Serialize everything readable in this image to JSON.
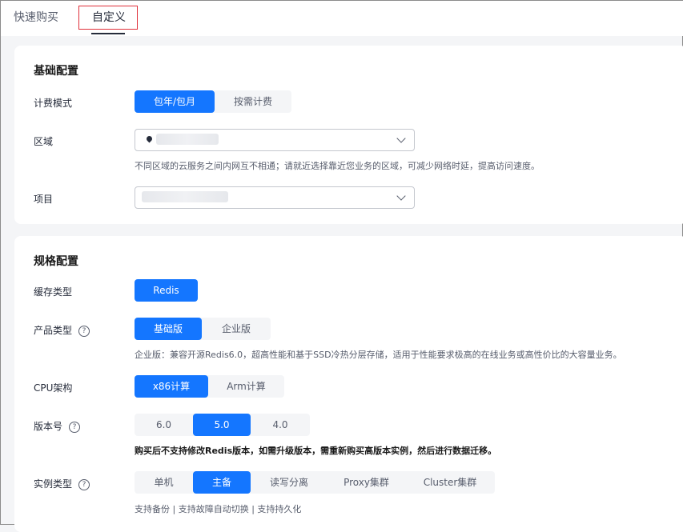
{
  "tabs": {
    "quick": "快速购买",
    "custom": "自定义"
  },
  "basic": {
    "title": "基础配置",
    "billing": {
      "label": "计费模式",
      "options": [
        "包年/包月",
        "按需计费"
      ],
      "selected": "包年/包月"
    },
    "region": {
      "label": "区域",
      "hint": "不同区域的云服务之间内网互不相通；请就近选择靠近您业务的区域，可减少网络时延，提高访问速度。"
    },
    "project": {
      "label": "项目"
    }
  },
  "spec": {
    "title": "规格配置",
    "cache_type": {
      "label": "缓存类型",
      "options": [
        "Redis"
      ],
      "selected": "Redis"
    },
    "product_type": {
      "label": "产品类型",
      "options": [
        "基础版",
        "企业版"
      ],
      "selected": "基础版",
      "hint": "企业版：兼容开源Redis6.0，超高性能和基于SSD冷热分层存储，适用于性能要求极高的在线业务或高性价比的大容量业务。"
    },
    "cpu": {
      "label": "CPU架构",
      "options": [
        "x86计算",
        "Arm计算"
      ],
      "selected": "x86计算"
    },
    "version": {
      "label": "版本号",
      "options": [
        "6.0",
        "5.0",
        "4.0"
      ],
      "selected": "5.0",
      "warning": "购买后不支持修改Redis版本，如需升级版本，需重新购买高版本实例，然后进行数据迁移。"
    },
    "instance_type": {
      "label": "实例类型",
      "options": [
        "单机",
        "主备",
        "读写分离",
        "Proxy集群",
        "Cluster集群"
      ],
      "selected": "主备",
      "hint": "支持备份 | 支持故障自动切换 | 支持持久化"
    }
  },
  "colors": {
    "accent": "#1476ff",
    "highlight_box": "#e0303a"
  },
  "icons": {
    "help": "question-circle-icon",
    "location": "location-pin-icon",
    "dropdown": "chevron-down-icon"
  }
}
